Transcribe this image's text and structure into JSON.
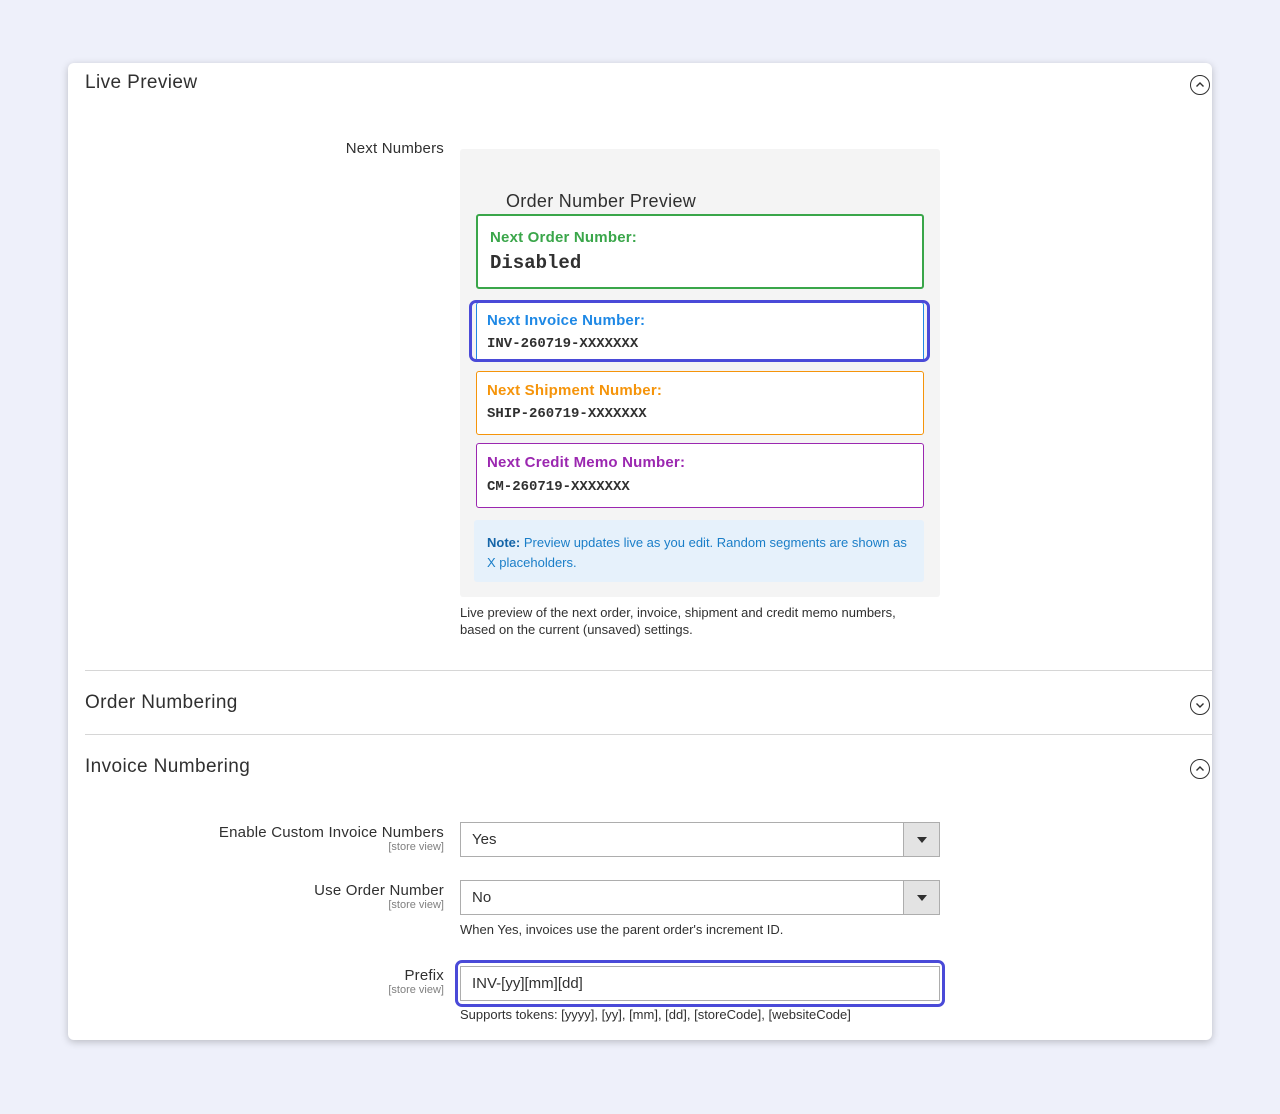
{
  "live_preview": {
    "title": "Live Preview",
    "field_label": "Next Numbers",
    "preview_title": "Order Number Preview",
    "order": {
      "label": "Next Order Number:",
      "value": "Disabled",
      "color": "#3aa64a"
    },
    "invoice": {
      "label": "Next Invoice Number:",
      "value": "INV-260719-XXXXXXX",
      "color": "#1e88e5"
    },
    "shipment": {
      "label": "Next Shipment Number:",
      "value": "SHIP-260719-XXXXXXX",
      "color": "#f5940a"
    },
    "credit_memo": {
      "label": "Next Credit Memo Number:",
      "value": "CM-260719-XXXXXXX",
      "color": "#9b27b0"
    },
    "note_label": "Note:",
    "note_text": "Preview updates live as you edit. Random segments are shown as X placeholders.",
    "help_line1": "Live preview of the next order, invoice, shipment and credit memo numbers,",
    "help_line2": "based on the current (unsaved) settings."
  },
  "order_numbering": {
    "title": "Order Numbering"
  },
  "invoice_numbering": {
    "title": "Invoice Numbering",
    "enable": {
      "label": "Enable Custom Invoice Numbers",
      "scope": "[store view]",
      "value": "Yes"
    },
    "use_order_number": {
      "label": "Use Order Number",
      "scope": "[store view]",
      "value": "No",
      "help": "When Yes, invoices use the parent order's increment ID."
    },
    "prefix": {
      "label": "Prefix",
      "scope": "[store view]",
      "value": "INV-[yy][mm][dd]",
      "help": "Supports tokens: [yyyy], [yy], [mm], [dd], [storeCode], [websiteCode]"
    }
  },
  "highlight_color": "#4a4ad8"
}
